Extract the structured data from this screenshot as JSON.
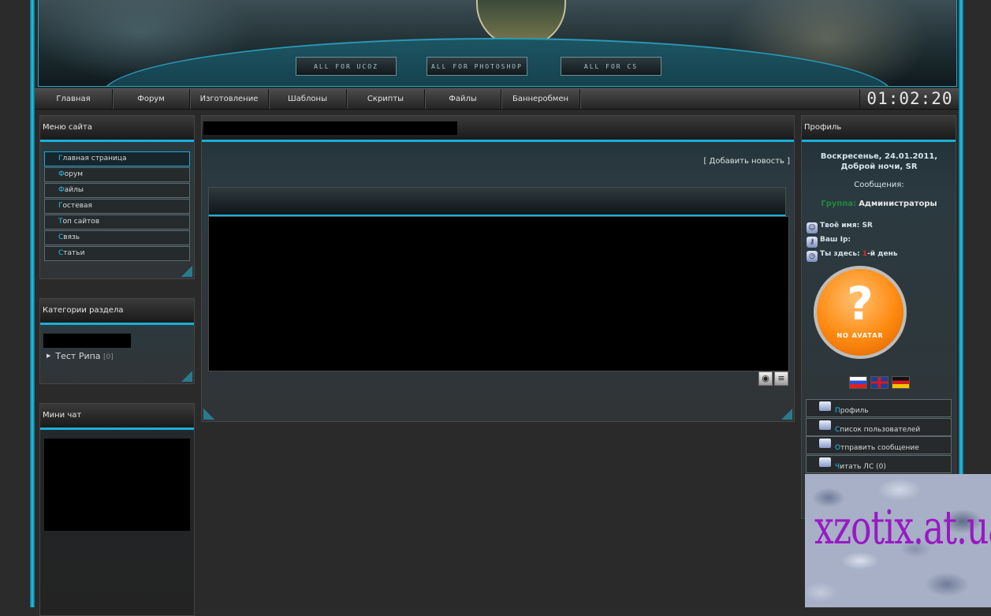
{
  "header": {
    "buttons": [
      "ALL FOR UCOZ",
      "ALL FOR PHOTOSHOP",
      "ALL FOR CS"
    ]
  },
  "nav": {
    "items": [
      "Главная",
      "Форум",
      "Изготовление",
      "Шаблоны",
      "Скрипты",
      "Файлы",
      "Баннеробмен"
    ],
    "clock": "01:02:20"
  },
  "left": {
    "menu_title": "Меню сайта",
    "menu_items": [
      "Главная страница",
      "Форум",
      "Файлы",
      "Гостевая",
      "Топ сайтов",
      "Связь",
      "Статьи"
    ],
    "categories_title": "Категории раздела",
    "category": {
      "name": "Тест Рипа",
      "count": "[0]"
    },
    "chat_title": "Мини чат"
  },
  "center": {
    "add_news": "[ Добавить новость ]"
  },
  "profile": {
    "title": "Профиль",
    "date": "Воскресенье, 24.01.2011,",
    "greeting": "Доброй ночи, SR",
    "messages": "Сообщения:",
    "group_label": "Группа:",
    "group_value": "Администраторы",
    "name_label": "Твоё имя:",
    "name_value": "SR",
    "ip_label": "Ваш Ip:",
    "here_prefix": "Ты здесь:",
    "here_num": "1",
    "here_suffix": "-й день",
    "avatar_text": "NO AVATAR",
    "links": [
      "Профиль",
      "Список пользователей",
      "Отправить сообщение",
      "Читать ЛС (0)"
    ]
  },
  "watermark": "xzotix.at.ua",
  "colors": {
    "accent": "#1ab0d8",
    "frame": "#27c3e6"
  }
}
